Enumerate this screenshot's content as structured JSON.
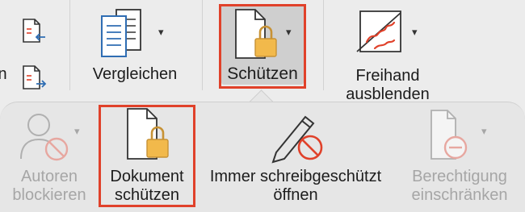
{
  "ribbon": {
    "compare": {
      "label": "Vergleichen",
      "icon": "compare-icon"
    },
    "protect": {
      "label": "Schützen",
      "icon": "protect-document-icon"
    },
    "ink": {
      "line1": "Freihand",
      "line2": "ausblenden",
      "icon": "hide-ink-icon"
    },
    "partial_left": "n"
  },
  "popup": {
    "block_authors": {
      "line1": "Autoren",
      "line2": "blockieren",
      "disabled": true
    },
    "protect_document": {
      "line1": "Dokument",
      "line2": "schützen"
    },
    "always_read_only": {
      "line1": "Immer schreibgeschützt",
      "line2": "öffnen"
    },
    "restrict_permission": {
      "line1": "Berechtigung",
      "line2": "einschränken",
      "disabled": true
    }
  },
  "colors": {
    "highlight": "#e0412a",
    "lock": "#f2b94b",
    "disabled": "#a6a6a6",
    "accent_blue": "#2f6db3"
  }
}
